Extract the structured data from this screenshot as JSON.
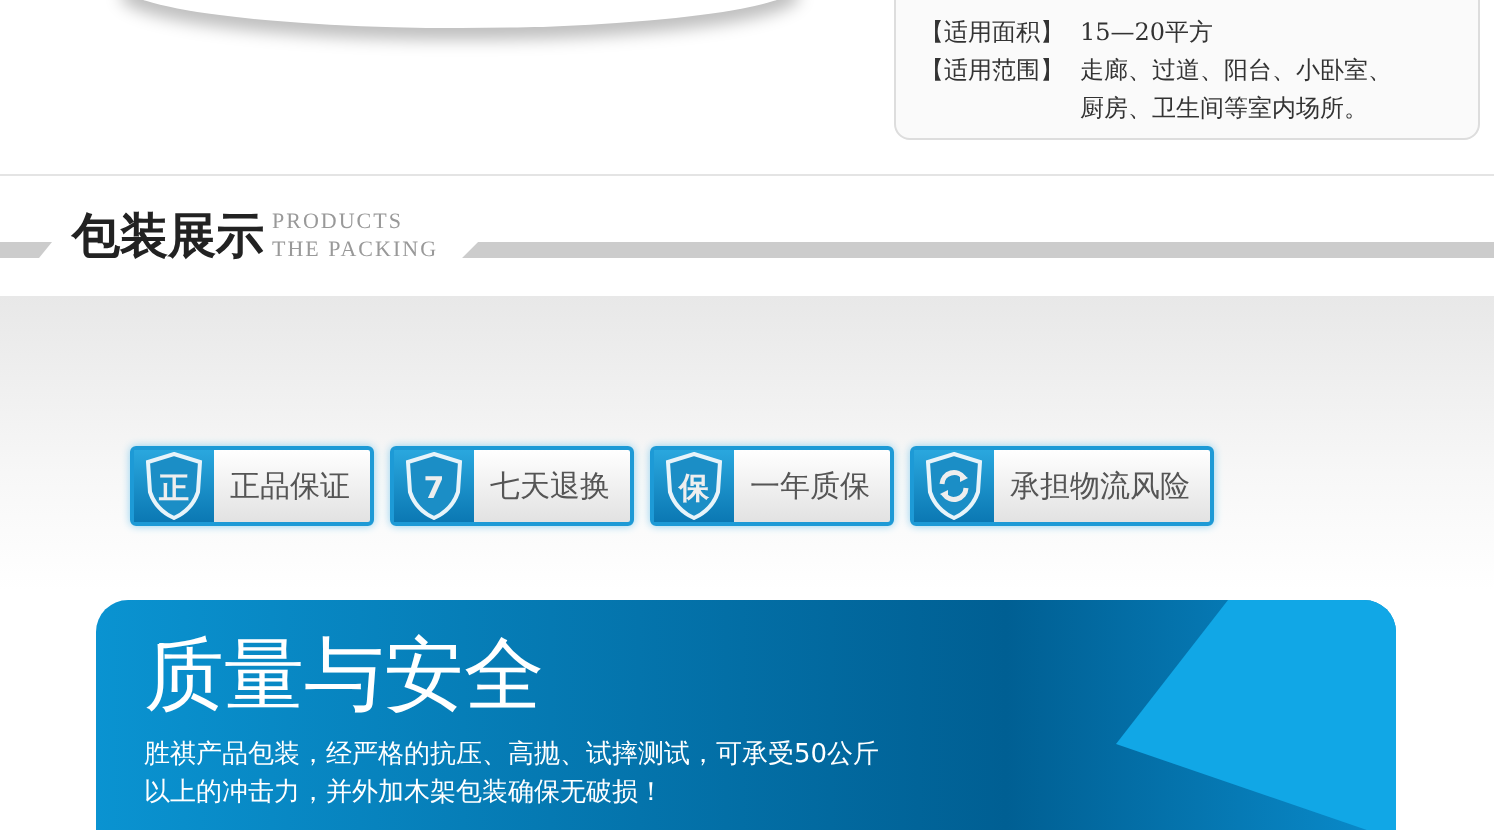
{
  "specs": [
    {
      "label": "【适用面积】",
      "value": "15—20平方"
    },
    {
      "label": "【适用范围】",
      "value": "走廊、过道、阳台、小卧室、厨房、卫生间等室内场所。"
    }
  ],
  "section": {
    "title": "包装展示",
    "subtitle_lines": [
      "PRODUCTS",
      "THE PACKING"
    ]
  },
  "badges": [
    {
      "kind": "symbol",
      "symbol": "正",
      "label": "正品保证"
    },
    {
      "kind": "symbol",
      "symbol": "7",
      "label": "七天退换"
    },
    {
      "kind": "symbol",
      "symbol": "保",
      "label": "一年质保"
    },
    {
      "kind": "refresh",
      "label": "承担物流风险"
    }
  ],
  "banner": {
    "title": "质量与安全",
    "text_lines": [
      "胜祺产品包装，经严格的抗压、高抛、试摔测试，可承受50公斤",
      "以上的冲击力，并外加木架包装确保无破损！"
    ]
  }
}
